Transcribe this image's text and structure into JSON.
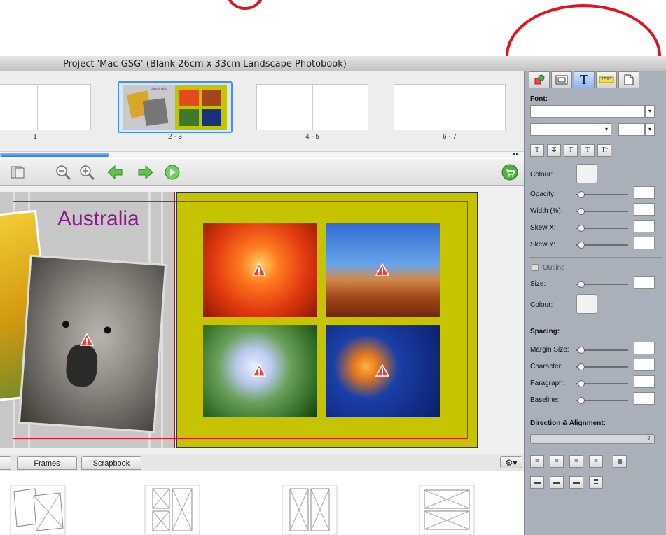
{
  "window": {
    "title": "Project 'Mac GSG' (Blank 26cm x 33cm Landscape Photobook)"
  },
  "thumbnails": {
    "labels": [
      "1",
      "2 - 3",
      "4 - 5",
      "6 - 7"
    ],
    "selected": "2 - 3",
    "scroll_arrows": "◂ ▸"
  },
  "toolbar": {
    "icons": [
      "pages-icon",
      "zoom-out-icon",
      "zoom-in-icon",
      "previous-page-arrow-icon",
      "next-page-arrow-icon",
      "play-slideshow-icon",
      "shopping-cart-icon"
    ]
  },
  "canvas": {
    "left_page_title": "Australia",
    "left_page_photos": [
      "yellow-flower-photo",
      "koala-photo"
    ],
    "right_page_photos": [
      "red-dahlia-photo",
      "desert-mesa-photo",
      "hydrangea-photo",
      "jellyfish-photo"
    ],
    "warning_icon": "low-resolution-warning-icon",
    "page_color": "#c6c400"
  },
  "bottom_tabs": {
    "items": [
      "Frames",
      "Scrapbook"
    ],
    "gear_label": "⚙▾"
  },
  "panel": {
    "tabs": [
      "fill-tab",
      "frame-tab",
      "text-tab",
      "ruler-tab",
      "page-tab"
    ],
    "text_tab_glyph": "T",
    "font_heading": "Font:",
    "style_buttons": [
      "T",
      "T",
      "T",
      "T",
      "Tr"
    ],
    "colour_label": "Colour:",
    "opacity_label": "Opacity:",
    "width_label": "Width (%):",
    "skewx_label": "Skew X:",
    "skewy_label": "Skew Y:",
    "outline_label": "Outline",
    "size_label": "Size:",
    "outline_colour_label": "Colour:",
    "spacing_heading": "Spacing:",
    "margin_label": "Margin Size:",
    "character_label": "Character:",
    "paragraph_label": "Paragraph:",
    "baseline_label": "Baseline:",
    "direction_heading": "Direction & Alignment:"
  },
  "annotation_color": "#e0141e"
}
